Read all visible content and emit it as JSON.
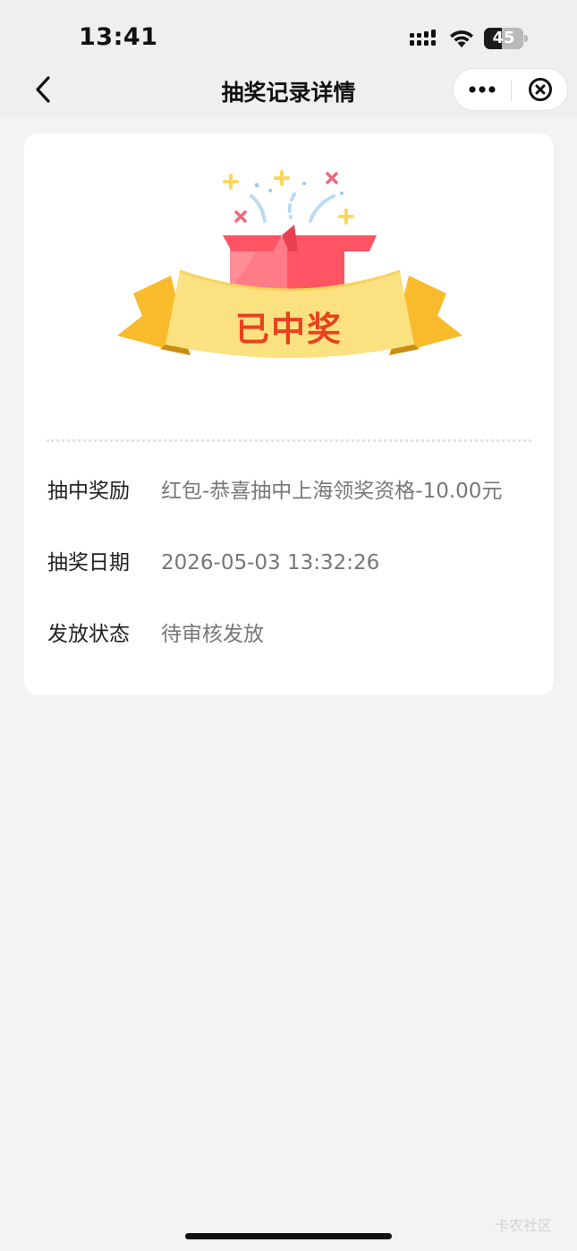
{
  "status_bar": {
    "time": "13:41",
    "battery_level": "45",
    "icons": [
      "signal-icon",
      "wifi-icon",
      "battery-icon"
    ]
  },
  "nav": {
    "title": "抽奖记录详情",
    "back_icon": "chevron-left-icon",
    "more_icon": "more-dots-icon",
    "close_icon": "close-circle-icon"
  },
  "prize": {
    "banner_text": "已中奖",
    "graphic": "gift-box-ribbon-icon"
  },
  "details": [
    {
      "label": "抽中奖励",
      "value": "红包-恭喜抽中上海领奖资格-10.00元"
    },
    {
      "label": "抽奖日期",
      "value": "2026-05-03 13:32:26"
    },
    {
      "label": "发放状态",
      "value": "待审核发放"
    }
  ],
  "watermark": "卡农社区",
  "colors": {
    "background": "#f2f3f5",
    "banner_text": "#e8421f",
    "ribbon": "#fbe17f",
    "gift_box": "#fe5463"
  }
}
